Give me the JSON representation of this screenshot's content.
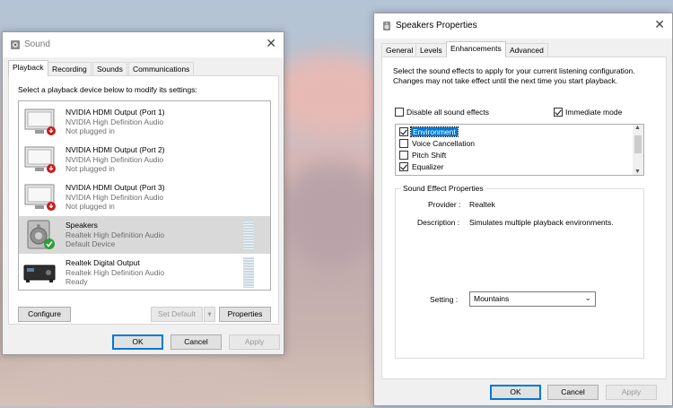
{
  "sound_window": {
    "title": "Sound",
    "close_glyph": "✕",
    "tabs": [
      "Playback",
      "Recording",
      "Sounds",
      "Communications"
    ],
    "active_tab": 0,
    "instruction": "Select a playback device below to modify its settings:",
    "devices": [
      {
        "name": "NVIDIA HDMI Output (Port 1)",
        "driver": "NVIDIA High Definition Audio",
        "status": "Not plugged in",
        "icon": "monitor-icon"
      },
      {
        "name": "NVIDIA HDMI Output (Port 2)",
        "driver": "NVIDIA High Definition Audio",
        "status": "Not plugged in",
        "icon": "monitor-icon"
      },
      {
        "name": "NVIDIA HDMI Output (Port 3)",
        "driver": "NVIDIA High Definition Audio",
        "status": "Not plugged in",
        "icon": "monitor-icon"
      },
      {
        "name": "Speakers",
        "driver": "Realtek High Definition Audio",
        "status": "Default Device",
        "icon": "speaker-icon"
      },
      {
        "name": "Realtek Digital Output",
        "driver": "Realtek High Definition Audio",
        "status": "Ready",
        "icon": "digital-output-icon"
      }
    ],
    "selected_device": 3,
    "buttons": {
      "configure": "Configure",
      "set_default": "Set Default",
      "set_default_arrow": "▾",
      "properties": "Properties",
      "ok": "OK",
      "cancel": "Cancel",
      "apply": "Apply"
    }
  },
  "speakers_window": {
    "title": "Speakers Properties",
    "close_glyph": "✕",
    "tabs": [
      "General",
      "Levels",
      "Enhancements",
      "Advanced"
    ],
    "active_tab": 2,
    "description": "Select the sound effects to apply for your current listening configuration. Changes may not take effect until the next time you start playback.",
    "disable_all_label": "Disable all sound effects",
    "disable_all_checked": false,
    "immediate_mode_label": "Immediate mode",
    "immediate_mode_checked": true,
    "effects": [
      {
        "label": "Environment",
        "checked": true
      },
      {
        "label": "Voice Cancellation",
        "checked": false
      },
      {
        "label": "Pitch Shift",
        "checked": false
      },
      {
        "label": "Equalizer",
        "checked": true
      }
    ],
    "selected_effect": 0,
    "scroll_up": "▲",
    "scroll_down": "▼",
    "properties_group": {
      "title": "Sound Effect Properties",
      "provider_label": "Provider :",
      "provider_value": "Realtek",
      "description_label": "Description :",
      "description_value": "Simulates multiple playback environments.",
      "setting_label": "Setting :",
      "setting_value": "Mountains",
      "setting_arrow": "⌄"
    },
    "buttons": {
      "ok": "OK",
      "cancel": "Cancel",
      "apply": "Apply"
    }
  },
  "colors": {
    "accent": "#0078d7",
    "selected_row": "#d9d9d9",
    "window_bg": "#f0f0f0"
  }
}
